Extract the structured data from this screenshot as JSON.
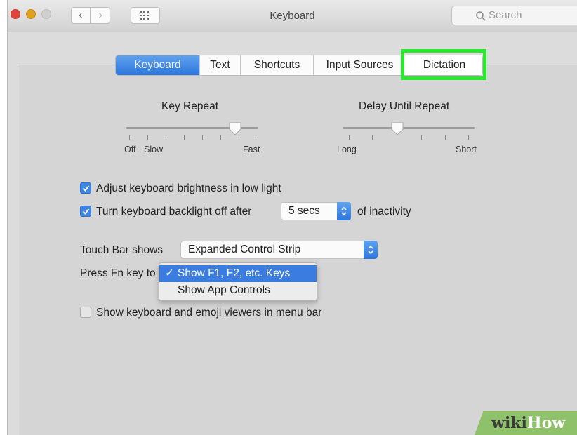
{
  "window": {
    "title": "Keyboard"
  },
  "search": {
    "placeholder": "Search"
  },
  "tabs": [
    {
      "label": "Keyboard",
      "active": true
    },
    {
      "label": "Text"
    },
    {
      "label": "Shortcuts"
    },
    {
      "label": "Input Sources"
    },
    {
      "label": "Dictation"
    }
  ],
  "key_repeat": {
    "title": "Key Repeat",
    "min_label": "Off",
    "slow_label": "Slow",
    "max_label": "Fast",
    "level": 0.85
  },
  "delay_until_repeat": {
    "title": "Delay Until Repeat",
    "min_label": "Long",
    "max_label": "Short",
    "level": 0.4
  },
  "options": {
    "brightness": {
      "label": "Adjust keyboard brightness in low light",
      "checked": true
    },
    "backlight": {
      "label": "Turn keyboard backlight off after",
      "value": "5 secs",
      "suffix": "of inactivity",
      "checked": true
    },
    "viewers": {
      "label": "Show keyboard and emoji viewers in menu bar",
      "checked": false
    }
  },
  "touch_bar": {
    "label": "Touch Bar shows",
    "value": "Expanded Control Strip"
  },
  "fn_key": {
    "label": "Press Fn key to",
    "menu": [
      {
        "label": "Show F1, F2, etc. Keys",
        "selected": true
      },
      {
        "label": "Show App Controls",
        "selected": false
      }
    ]
  },
  "watermark": {
    "part1": "wiki",
    "part2": "How"
  },
  "colors": {
    "accent": "#3a7ce0",
    "highlight": "#29e82d"
  }
}
